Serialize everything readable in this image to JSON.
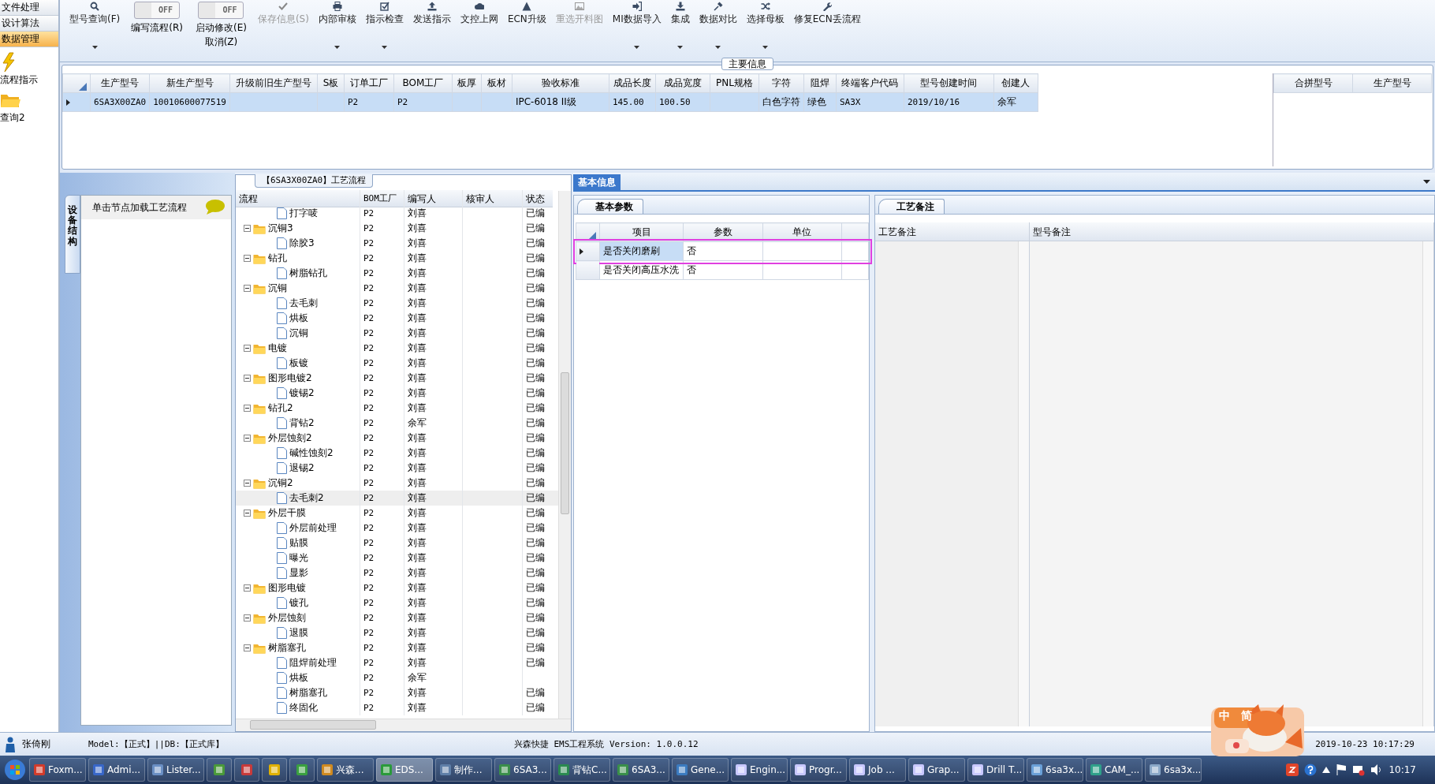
{
  "sidebar": {
    "items": [
      {
        "label": "文件处理",
        "selected": false
      },
      {
        "label": "设计算法",
        "selected": false
      },
      {
        "label": "数据管理",
        "selected": true
      }
    ],
    "tools": [
      {
        "label": "流程指示"
      },
      {
        "label": "查询2"
      }
    ]
  },
  "toolbar": {
    "buttons": [
      {
        "kind": "button",
        "label": "型号查询(F)",
        "dropdown": true,
        "disabled": false
      },
      {
        "kind": "toggle",
        "label": "编写流程(R)",
        "state_text": "OFF",
        "on": false
      },
      {
        "kind": "toggle",
        "label": "启动修改(E)",
        "state_text": "OFF",
        "on": false,
        "extra_button": "取消(Z)"
      },
      {
        "kind": "button",
        "label": "保存信息(S)",
        "dropdown": false,
        "disabled": true
      },
      {
        "kind": "button",
        "label": "内部审核",
        "dropdown": true,
        "disabled": false
      },
      {
        "kind": "button",
        "label": "指示检查",
        "dropdown": true,
        "disabled": false
      },
      {
        "kind": "button",
        "label": "发送指示",
        "dropdown": false,
        "disabled": false
      },
      {
        "kind": "button",
        "label": "文控上网",
        "dropdown": false,
        "disabled": false
      },
      {
        "kind": "button",
        "label": "ECN升级",
        "dropdown": false,
        "disabled": false
      },
      {
        "kind": "button",
        "label": "重选开料图",
        "dropdown": false,
        "disabled": true
      },
      {
        "kind": "button",
        "label": "MI数据导入",
        "dropdown": true,
        "disabled": false
      },
      {
        "kind": "button",
        "label": "集成",
        "dropdown": true,
        "disabled": false
      },
      {
        "kind": "button",
        "label": "数据对比",
        "dropdown": true,
        "disabled": false
      },
      {
        "kind": "button",
        "label": "选择母板",
        "dropdown": true,
        "disabled": false
      },
      {
        "kind": "button",
        "label": "修复ECN丢流程",
        "dropdown": false,
        "disabled": false
      }
    ]
  },
  "main_info": {
    "title": "主要信息",
    "columns": [
      "生产型号",
      "新生产型号",
      "升级前旧生产型号",
      "S板",
      "订单工厂",
      "BOM工厂",
      "板厚",
      "板材",
      "验收标准",
      "成品长度",
      "成品宽度",
      "PNL规格",
      "字符",
      "阻焊",
      "终端客户代码",
      "型号创建时间",
      "创建人"
    ],
    "rows": [
      {
        "selected": true,
        "cells": [
          "6SA3X00ZA0",
          "10010600077519",
          null,
          null,
          "P2",
          "P2",
          null,
          null,
          "IPC-6018 II级",
          "145.00",
          "100.50",
          null,
          "白色字符",
          "绿色",
          "SA3X",
          "2019/10/16",
          "余军"
        ]
      }
    ],
    "merge_table": {
      "columns": [
        "合拼型号",
        "生产型号"
      ]
    }
  },
  "structure_panel": {
    "vertical_tab": "设备结构",
    "header": "单击节点加载工艺流程"
  },
  "process_tree": {
    "title": "【6SA3X00ZA0】工艺流程",
    "columns": [
      "流程",
      "BOM工厂",
      "编写人",
      "核审人",
      "状态"
    ],
    "nodes": [
      {
        "children": [
          {
            "name": "打字唛",
            "bom": "P2",
            "writer": "刘喜",
            "status": "已编",
            "selected": false
          }
        ]
      },
      {
        "name": "沉铜3",
        "bom": "P2",
        "writer": "刘喜",
        "status": "已编",
        "expanded": true,
        "selected": false,
        "children": [
          {
            "name": "除胶3",
            "bom": "P2",
            "writer": "刘喜",
            "status": "已编",
            "selected": false
          }
        ]
      },
      {
        "name": "钻孔",
        "bom": "P2",
        "writer": "刘喜",
        "status": "已编",
        "expanded": true,
        "selected": false,
        "children": [
          {
            "name": "树脂钻孔",
            "bom": "P2",
            "writer": "刘喜",
            "status": "已编",
            "selected": false
          }
        ]
      },
      {
        "name": "沉铜",
        "bom": "P2",
        "writer": "刘喜",
        "status": "已编",
        "expanded": true,
        "selected": false,
        "children": [
          {
            "name": "去毛刺",
            "bom": "P2",
            "writer": "刘喜",
            "status": "已编",
            "selected": false
          },
          {
            "name": "烘板",
            "bom": "P2",
            "writer": "刘喜",
            "status": "已编",
            "selected": false
          },
          {
            "name": "沉铜",
            "bom": "P2",
            "writer": "刘喜",
            "status": "已编",
            "selected": false
          }
        ]
      },
      {
        "name": "电镀",
        "bom": "P2",
        "writer": "刘喜",
        "status": "已编",
        "expanded": true,
        "selected": false,
        "children": [
          {
            "name": "板镀",
            "bom": "P2",
            "writer": "刘喜",
            "status": "已编",
            "selected": false
          }
        ]
      },
      {
        "name": "图形电镀2",
        "bom": "P2",
        "writer": "刘喜",
        "status": "已编",
        "expanded": true,
        "selected": false,
        "children": [
          {
            "name": "镀锡2",
            "bom": "P2",
            "writer": "刘喜",
            "status": "已编",
            "selected": false
          }
        ]
      },
      {
        "name": "钻孔2",
        "bom": "P2",
        "writer": "刘喜",
        "status": "已编",
        "expanded": true,
        "selected": false,
        "children": [
          {
            "name": "背钻2",
            "bom": "P2",
            "writer": "余军",
            "status": "已编",
            "selected": false
          }
        ]
      },
      {
        "name": "外层蚀刻2",
        "bom": "P2",
        "writer": "刘喜",
        "status": "已编",
        "expanded": true,
        "selected": false,
        "children": [
          {
            "name": "碱性蚀刻2",
            "bom": "P2",
            "writer": "刘喜",
            "status": "已编",
            "selected": false
          },
          {
            "name": "退锡2",
            "bom": "P2",
            "writer": "刘喜",
            "status": "已编",
            "selected": false
          }
        ]
      },
      {
        "name": "沉铜2",
        "bom": "P2",
        "writer": "刘喜",
        "status": "已编",
        "expanded": true,
        "selected": false,
        "children": [
          {
            "name": "去毛刺2",
            "bom": "P2",
            "writer": "刘喜",
            "status": "已编",
            "selected": true
          }
        ]
      },
      {
        "name": "外层干膜",
        "bom": "P2",
        "writer": "刘喜",
        "status": "已编",
        "expanded": true,
        "selected": false,
        "children": [
          {
            "name": "外层前处理",
            "bom": "P2",
            "writer": "刘喜",
            "status": "已编",
            "selected": false
          },
          {
            "name": "贴膜",
            "bom": "P2",
            "writer": "刘喜",
            "status": "已编",
            "selected": false
          },
          {
            "name": "曝光",
            "bom": "P2",
            "writer": "刘喜",
            "status": "已编",
            "selected": false
          },
          {
            "name": "显影",
            "bom": "P2",
            "writer": "刘喜",
            "status": "已编",
            "selected": false
          }
        ]
      },
      {
        "name": "图形电镀",
        "bom": "P2",
        "writer": "刘喜",
        "status": "已编",
        "expanded": true,
        "selected": false,
        "children": [
          {
            "name": "镀孔",
            "bom": "P2",
            "writer": "刘喜",
            "status": "已编",
            "selected": false
          }
        ]
      },
      {
        "name": "外层蚀刻",
        "bom": "P2",
        "writer": "刘喜",
        "status": "已编",
        "expanded": true,
        "selected": false,
        "children": [
          {
            "name": "退膜",
            "bom": "P2",
            "writer": "刘喜",
            "status": "已编",
            "selected": false
          }
        ]
      },
      {
        "name": "树脂塞孔",
        "bom": "P2",
        "writer": "刘喜",
        "status": "已编",
        "expanded": true,
        "selected": false,
        "children": [
          {
            "name": "阻焊前处理",
            "bom": "P2",
            "writer": "刘喜",
            "status": "已编",
            "selected": false
          },
          {
            "name": "烘板",
            "bom": "P2",
            "writer": "余军",
            "selected": false
          },
          {
            "name": "树脂塞孔",
            "bom": "P2",
            "writer": "刘喜",
            "status": "已编",
            "selected": false
          },
          {
            "name": "终固化",
            "bom": "P2",
            "writer": "刘喜",
            "status": "已编",
            "selected": false
          }
        ]
      }
    ]
  },
  "detail_tabs": [
    {
      "label": "基本信息",
      "selected": true
    }
  ],
  "params_panel": {
    "tab": "基本参数",
    "columns": [
      "项目",
      "参数",
      "单位"
    ],
    "rows": [
      {
        "item": "是否关闭磨刷",
        "value": "否",
        "selected": true,
        "highlighted": true
      },
      {
        "item": "是否关闭高压水洗",
        "value": "否",
        "selected": false,
        "highlighted": false
      }
    ]
  },
  "notes_panel": {
    "tab": "工艺备注",
    "columns": [
      "工艺备注",
      "型号备注"
    ]
  },
  "status_bar": {
    "user": "张倚刚",
    "model": "Model:【正式】||DB:【正式库】",
    "app": "兴森快捷 EMS工程系统 Version: 1.0.0.12",
    "datetime": "2019-10-23 10:17:29"
  },
  "ime_widget": {
    "labels": [
      "中",
      "简"
    ]
  },
  "taskbar": {
    "items": [
      {
        "kind": "app",
        "label": "Foxm...",
        "selected": false
      },
      {
        "kind": "app",
        "label": "Admi...",
        "selected": false
      },
      {
        "kind": "app",
        "label": "Lister...",
        "selected": false
      },
      {
        "kind": "icon",
        "selected": false
      },
      {
        "kind": "icon",
        "selected": false
      },
      {
        "kind": "icon",
        "selected": false
      },
      {
        "kind": "icon",
        "selected": false
      },
      {
        "kind": "app",
        "label": "兴森...",
        "selected": false
      },
      {
        "kind": "app",
        "label": "EDS...",
        "selected": true
      },
      {
        "kind": "app",
        "label": "制作...",
        "selected": false
      },
      {
        "kind": "app",
        "label": "6SA3...",
        "selected": false
      },
      {
        "kind": "app",
        "label": "背钻C...",
        "selected": false
      },
      {
        "kind": "app",
        "label": "6SA3...",
        "selected": false
      },
      {
        "kind": "app",
        "label": "Gene...",
        "selected": false
      },
      {
        "kind": "app",
        "label": "Engin...",
        "selected": false
      },
      {
        "kind": "app",
        "label": "Progr...",
        "selected": false
      },
      {
        "kind": "app",
        "label": "Job ...",
        "selected": false
      },
      {
        "kind": "app",
        "label": "Grap...",
        "selected": false
      },
      {
        "kind": "app",
        "label": "Drill T...",
        "selected": false
      },
      {
        "kind": "app",
        "label": "6sa3x...",
        "selected": false
      },
      {
        "kind": "app",
        "label": "CAM_...",
        "selected": false
      },
      {
        "kind": "app",
        "label": "6sa3x...",
        "selected": false
      }
    ],
    "clock": "10:17"
  }
}
